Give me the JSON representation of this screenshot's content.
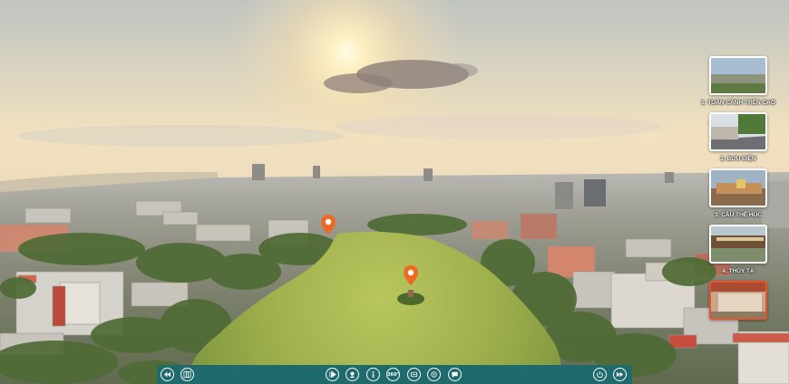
{
  "scenes": [
    {
      "label": "1. TOÀN CẢNH TRÊN CAO",
      "active": false
    },
    {
      "label": "2. BƯU ĐIỆN",
      "active": false
    },
    {
      "label": "3. CẦU THÊ HÚC",
      "active": false
    },
    {
      "label": "4. THỦY TẠ",
      "active": false
    },
    {
      "label": "",
      "active": true
    }
  ],
  "toolbar": {
    "prev_icon": "rewind-icon",
    "map_icon": "map-icon",
    "play_icon": "play-icon",
    "hotspot_icon": "hotspot-icon",
    "info_icon": "info-icon",
    "vr_label": "360°",
    "gyro_icon": "gyro-icon",
    "target_icon": "target-icon",
    "chat_icon": "chat-icon",
    "power_icon": "power-icon",
    "next_icon": "forward-icon"
  },
  "colors": {
    "toolbar_bg": "#1f6a6d",
    "pin": "#ee6a23",
    "active_thumb_border": "#e8542a"
  }
}
